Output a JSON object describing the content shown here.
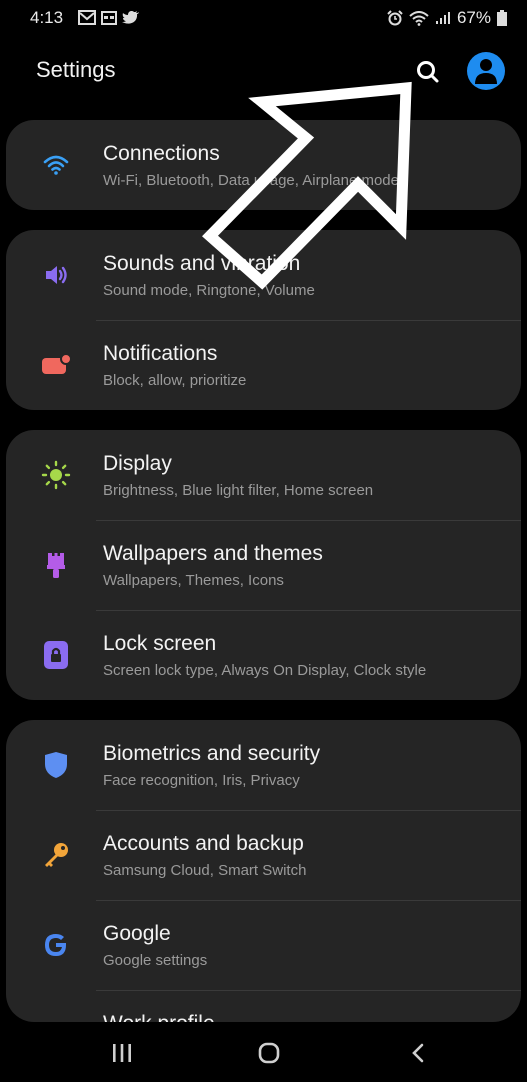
{
  "status_bar": {
    "time": "4:13",
    "battery": "67%"
  },
  "header": {
    "title": "Settings"
  },
  "groups": [
    {
      "items": [
        {
          "title": "Connections",
          "subtitle": "Wi-Fi, Bluetooth, Data usage, Airplane mode",
          "icon": "wifi-icon",
          "color": "#3aa0f5"
        }
      ]
    },
    {
      "items": [
        {
          "title": "Sounds and vibration",
          "subtitle": "Sound mode, Ringtone, Volume",
          "icon": "volume-icon",
          "color": "#8a6cf0"
        },
        {
          "title": "Notifications",
          "subtitle": "Block, allow, prioritize",
          "icon": "notification-icon",
          "color": "#f0685e"
        }
      ]
    },
    {
      "items": [
        {
          "title": "Display",
          "subtitle": "Brightness, Blue light filter, Home screen",
          "icon": "sun-icon",
          "color": "#a6d84a"
        },
        {
          "title": "Wallpapers and themes",
          "subtitle": "Wallpapers, Themes, Icons",
          "icon": "paintbrush-icon",
          "color": "#b45ce8"
        },
        {
          "title": "Lock screen",
          "subtitle": "Screen lock type, Always On Display, Clock style",
          "icon": "lock-icon",
          "color": "#8a6cf0"
        }
      ]
    },
    {
      "items": [
        {
          "title": "Biometrics and security",
          "subtitle": "Face recognition, Iris, Privacy",
          "icon": "shield-icon",
          "color": "#5d8ff2"
        },
        {
          "title": "Accounts and backup",
          "subtitle": "Samsung Cloud, Smart Switch",
          "icon": "key-icon",
          "color": "#f2a53a"
        },
        {
          "title": "Google",
          "subtitle": "Google settings",
          "icon": "google-icon",
          "color": "#4a86f0"
        },
        {
          "title": "Work profile",
          "subtitle": "",
          "icon": "briefcase-icon",
          "color": "#3aa0f5"
        }
      ]
    }
  ],
  "colors": {
    "background": "#000000",
    "card": "#252525",
    "title_text": "#f3f3f3",
    "subtitle_text": "#9a9a9a",
    "accent": "#1e8cf0"
  }
}
